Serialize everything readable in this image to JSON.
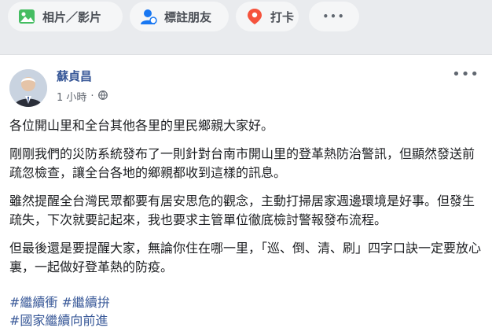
{
  "composer": {
    "photo_label": "相片／影片",
    "tag_label": "標註朋友",
    "checkin_label": "打卡",
    "more_label": "•••"
  },
  "post": {
    "author": "蘇貞昌",
    "time": "1 小時",
    "separator": "·",
    "paragraphs": [
      "各位開山里和全台其他各里的里民鄉親大家好。",
      "剛剛我們的災防系統發布了一則針對台南市開山里的登革熱防治警訊，但顯然發送前疏忽檢查，讓全台各地的鄉親都收到這樣的訊息。",
      "雖然提醒全台灣民眾都要有居安思危的觀念，主動打掃居家週邊環境是好事。但發生疏失，下次就要記起來，我也要求主管單位徹底檢討警報發布流程。",
      "但最後還是要提醒大家，無論你住在哪一里，「巡、倒、清、刷」四字口訣一定要放心裏，一起做好登革熱的防疫。"
    ],
    "hashtags": [
      "#繼續衝",
      "#繼續拚",
      "#國家繼續向前進"
    ],
    "more_options": "•••"
  }
}
